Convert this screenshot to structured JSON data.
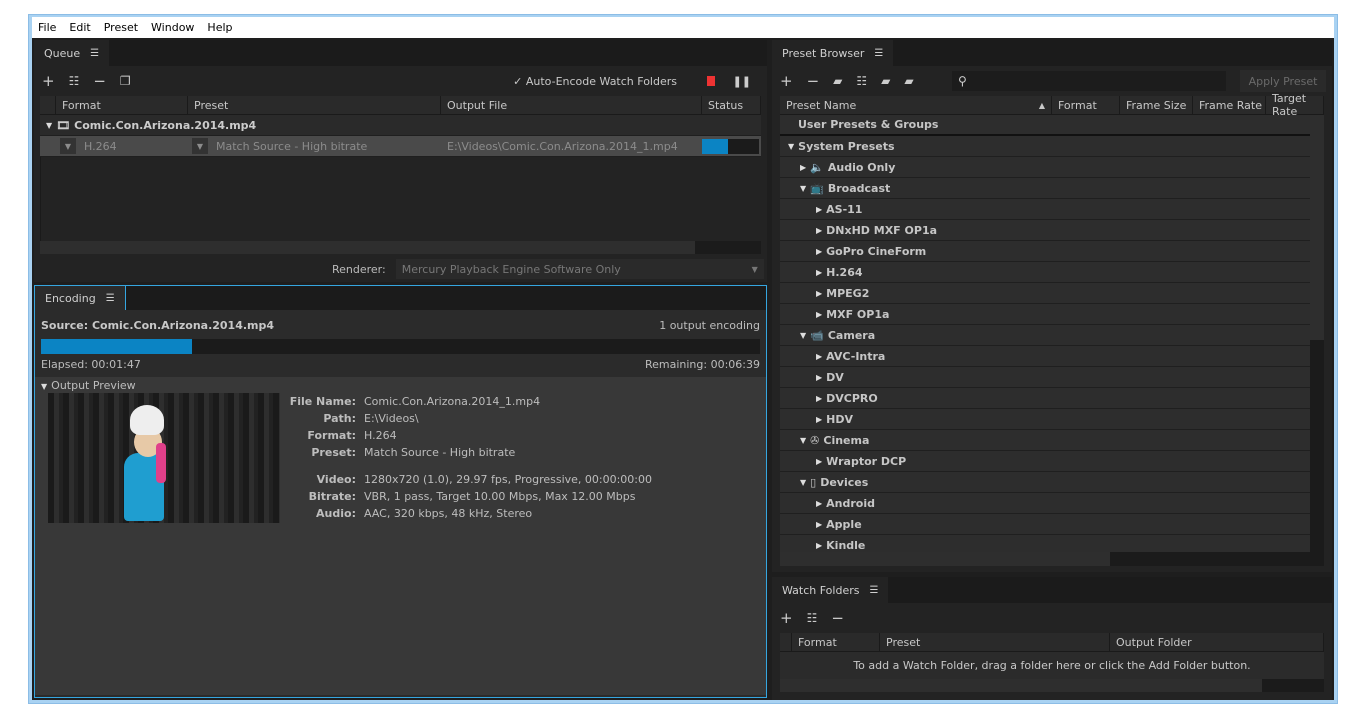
{
  "menu": [
    "File",
    "Edit",
    "Preset",
    "Window",
    "Help"
  ],
  "queue": {
    "tab": "Queue",
    "auto_encode": "Auto-Encode Watch Folders",
    "auto_encode_checked": true,
    "columns": [
      "Format",
      "Preset",
      "Output File",
      "Status"
    ],
    "group": "Comic.Con.Arizona.2014.mp4",
    "item": {
      "format": "H.264",
      "preset": "Match Source - High bitrate",
      "output": "E:\\Videos\\Comic.Con.Arizona.2014_1.mp4",
      "progress": 0.45
    },
    "renderer_label": "Renderer:",
    "renderer_value": "Mercury Playback Engine Software Only"
  },
  "encoding": {
    "tab": "Encoding",
    "source": "Source: Comic.Con.Arizona.2014.mp4",
    "count": "1 output encoding",
    "progress": 0.21,
    "elapsed": "Elapsed: 00:01:47",
    "remaining": "Remaining: 00:06:39",
    "preview_label": "Output Preview",
    "info": [
      {
        "k": "File Name:",
        "v": "Comic.Con.Arizona.2014_1.mp4"
      },
      {
        "k": "Path:",
        "v": "E:\\Videos\\"
      },
      {
        "k": "Format:",
        "v": "H.264"
      },
      {
        "k": "Preset:",
        "v": "Match Source - High bitrate"
      },
      {
        "k": "Video:",
        "v": "1280x720 (1.0), 29.97 fps, Progressive, 00:00:00:00"
      },
      {
        "k": "Bitrate:",
        "v": "VBR, 1 pass, Target 10.00 Mbps, Max 12.00 Mbps"
      },
      {
        "k": "Audio:",
        "v": "AAC, 320 kbps, 48 kHz, Stereo"
      }
    ]
  },
  "presets": {
    "tab": "Preset Browser",
    "apply": "Apply Preset",
    "columns": [
      "Preset Name",
      "Format",
      "Frame Size",
      "Frame Rate",
      "Target Rate"
    ],
    "user": "User Presets & Groups",
    "system": "System Presets",
    "tree": [
      {
        "l": "Audio Only",
        "d": 1,
        "open": false,
        "icon": "speaker-icon"
      },
      {
        "l": "Broadcast",
        "d": 1,
        "open": true,
        "icon": "tv-icon"
      },
      {
        "l": "AS-11",
        "d": 2
      },
      {
        "l": "DNxHD MXF OP1a",
        "d": 2
      },
      {
        "l": "GoPro CineForm",
        "d": 2
      },
      {
        "l": "H.264",
        "d": 2
      },
      {
        "l": "MPEG2",
        "d": 2
      },
      {
        "l": "MXF OP1a",
        "d": 2
      },
      {
        "l": "Camera",
        "d": 1,
        "open": true,
        "icon": "camera-icon"
      },
      {
        "l": "AVC-Intra",
        "d": 2
      },
      {
        "l": "DV",
        "d": 2
      },
      {
        "l": "DVCPRO",
        "d": 2
      },
      {
        "l": "HDV",
        "d": 2
      },
      {
        "l": "Cinema",
        "d": 1,
        "open": true,
        "icon": "film-reel-icon"
      },
      {
        "l": "Wraptor DCP",
        "d": 2
      },
      {
        "l": "Devices",
        "d": 1,
        "open": true,
        "icon": "phone-icon"
      },
      {
        "l": "Android",
        "d": 2
      },
      {
        "l": "Apple",
        "d": 2
      },
      {
        "l": "Kindle",
        "d": 2
      }
    ]
  },
  "watch": {
    "tab": "Watch Folders",
    "columns": [
      "Format",
      "Preset",
      "Output Folder"
    ],
    "empty": "To add a Watch Folder, drag a folder here or click the Add Folder button."
  }
}
